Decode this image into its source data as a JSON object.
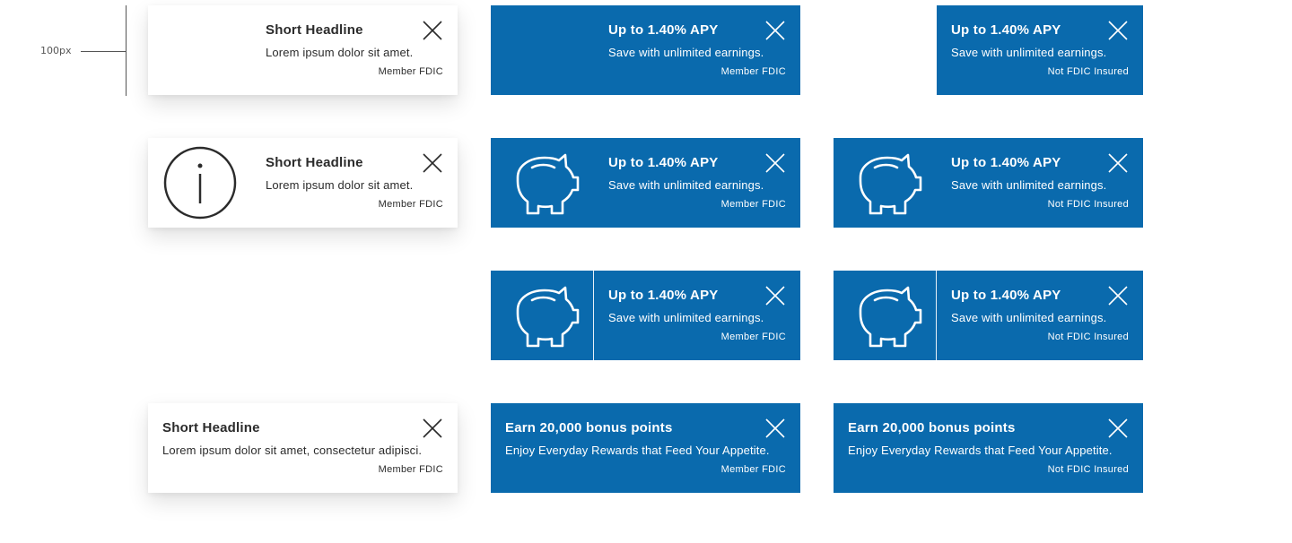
{
  "annotation": {
    "spacing_label": "100px"
  },
  "banners": {
    "r1c1": {
      "title": "Short Headline",
      "body": "Lorem ipsum dolor sit amet.",
      "fdic": "Member FDIC"
    },
    "r1c2": {
      "title": "Up to 1.40% APY",
      "body": "Save with unlimited earnings.",
      "fdic": "Member FDIC"
    },
    "r1c3": {
      "title": "Up to 1.40% APY",
      "body": "Save with unlimited earnings.",
      "fdic": "Not FDIC Insured"
    },
    "r2c1": {
      "title": "Short Headline",
      "body": "Lorem ipsum dolor sit amet.",
      "fdic": "Member FDIC",
      "icon": "info-icon"
    },
    "r2c2": {
      "title": "Up to 1.40% APY",
      "body": "Save with unlimited earnings.",
      "fdic": "Member FDIC",
      "icon": "piggy-bank-icon"
    },
    "r2c3": {
      "title": "Up to 1.40% APY",
      "body": "Save with unlimited earnings.",
      "fdic": "Not FDIC Insured",
      "icon": "piggy-bank-icon"
    },
    "r3c2": {
      "title": "Up to 1.40% APY",
      "body": "Save with unlimited earnings.",
      "fdic": "Member FDIC",
      "icon": "piggy-bank-icon"
    },
    "r3c3": {
      "title": "Up to 1.40% APY",
      "body": "Save with unlimited earnings.",
      "fdic": "Not FDIC Insured",
      "icon": "piggy-bank-icon"
    },
    "r4c1": {
      "title": "Short Headline",
      "body": "Lorem ipsum dolor sit amet, consectetur adipisci.",
      "fdic": "Member FDIC"
    },
    "r4c2": {
      "title": "Earn 20,000 bonus points",
      "body": "Enjoy Everyday Rewards that Feed Your Appetite.",
      "fdic": "Member FDIC"
    },
    "r4c3": {
      "title": "Earn 20,000 bonus points",
      "body": "Enjoy Everyday Rewards that Feed Your Appetite.",
      "fdic": "Not FDIC Insured"
    }
  },
  "colors": {
    "brand_blue": "#0a6aad",
    "text_dark": "#2b2b2b",
    "white": "#ffffff"
  }
}
